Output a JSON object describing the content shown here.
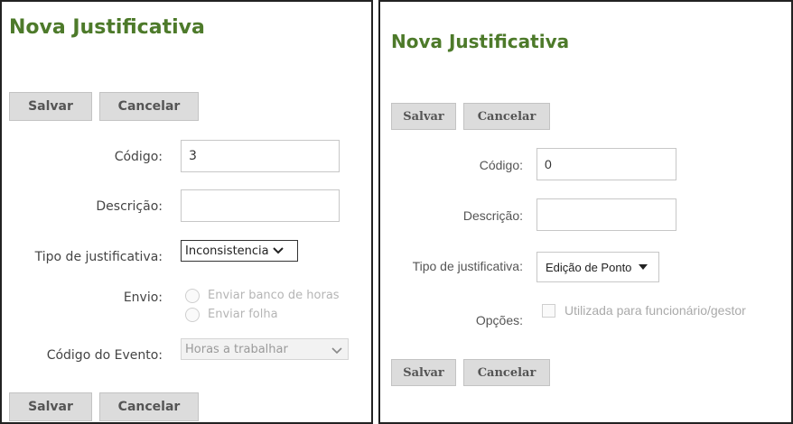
{
  "colors": {
    "title": "#4d7a2a",
    "button_bg": "#dcdcdc"
  },
  "left": {
    "title": "Nova Justificativa",
    "save_label": "Salvar",
    "cancel_label": "Cancelar",
    "codigo": {
      "label": "Código:",
      "value": "3"
    },
    "descricao": {
      "label": "Descrição:",
      "value": ""
    },
    "tipo": {
      "label": "Tipo de justificativa:",
      "value": "Inconsistencia"
    },
    "envio": {
      "label": "Envio:",
      "options": [
        "Enviar banco de horas",
        "Enviar folha"
      ]
    },
    "evento": {
      "label": "Código do Evento:",
      "value": "Horas a trabalhar"
    }
  },
  "right": {
    "title": "Nova Justificativa",
    "save_label": "Salvar",
    "cancel_label": "Cancelar",
    "codigo": {
      "label": "Código:",
      "value": "0"
    },
    "descricao": {
      "label": "Descrição:",
      "value": ""
    },
    "tipo": {
      "label": "Tipo de justificativa:",
      "value": "Edição de Ponto"
    },
    "opcoes": {
      "label": "Opções:",
      "checkbox_label": "Utilizada para funcionário/gestor"
    }
  }
}
